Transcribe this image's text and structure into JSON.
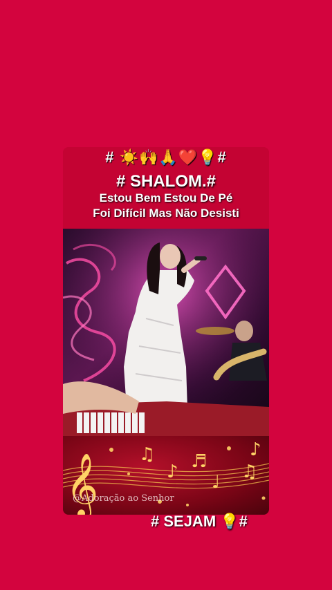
{
  "header": {
    "emoji_line": "# ☀️🙌🙏❤️💡#",
    "title": "# SHALOM.#",
    "subtitle_line1": "Estou Bem Estou De Pé",
    "subtitle_line2": "Foi Difícil Mas Não Desisti"
  },
  "watermark": "@Adoração ao Senhor",
  "footer": {
    "text": "# SEJAM 💡#"
  }
}
